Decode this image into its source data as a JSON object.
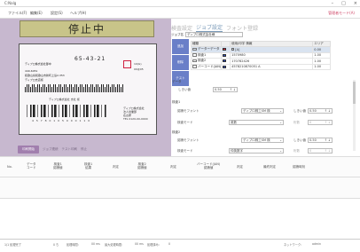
{
  "window": {
    "title": "C:Nalg",
    "admin_label": "管理者モード(A)"
  },
  "menu": {
    "items": [
      "ファイル(F)",
      "編集(E)",
      "設定(S)",
      "ヘルプ(H)"
    ]
  },
  "left": {
    "status_banner": "停止中",
    "label": {
      "postal_code": "65-43-21",
      "line1": "ディプロ株式会社御中",
      "line2": "440-6051",
      "line3": "和歌山県和歌山市新町上島2-353",
      "line4": "ディプロ支店様",
      "small1": "10(G)",
      "small2": "00@05",
      "info1": "ディプロ株式会社 支社 様",
      "info2": "ディプロ株式会社",
      "digits": "4 5 7 8 0 1 0 5 0 0 0 1 1 0",
      "company_lines": [
        "ディプロ株式会社",
        "法人営業部",
        "名古屋",
        "TEL 0120-00-0000"
      ]
    },
    "controls": {
      "btn1": "印刷開始",
      "chk1": "ジョブ連続",
      "chk2": "テスト印刷",
      "btn2": "停止"
    }
  },
  "right": {
    "tabs": [
      "検査設定",
      "ジョブ設定",
      "フォント登録"
    ],
    "active_tab": 1,
    "job_name_label": "ジョブ名",
    "job_name": "ディプロ株式会社様",
    "side_buttons": [
      "追加",
      "削除",
      "テスト"
    ],
    "table": {
      "headers": [
        "種類",
        "",
        "使用/印字 情報",
        "エリア"
      ],
      "rows": [
        {
          "type": "データーデータ",
          "color": "#e03040",
          "value": "[A]",
          "area": "0.00"
        },
        {
          "type": "検査1",
          "color": "#3050c0",
          "value": "1570980",
          "area": "1.00"
        },
        {
          "type": "検査2",
          "color": "#3050c0",
          "value": "170782426",
          "area": "1.00"
        },
        {
          "type": "バーコード(JAN)",
          "color": "#3050c0",
          "value": "4578210870051 A",
          "area": "1.00"
        }
      ]
    },
    "data_group": {
      "title": "データ",
      "threshold_label": "しきい値",
      "threshold_value": "0.50"
    },
    "check1": {
      "title": "検査1",
      "font_label": "認識モフォント",
      "font_value": "ディプロ株工SM 検",
      "threshold_label": "しきい値",
      "threshold_value": "0.50",
      "mode_label": "検査モード",
      "mode_value": "英数",
      "char_label": "桁数",
      "char_value": "0"
    },
    "check2": {
      "title": "検査2",
      "font_label": "認識モフォント",
      "font_value": "ディプロ株工SM 検",
      "threshold_label": "しきい値",
      "threshold_value": "0.50",
      "mode_label": "検査モード",
      "mode_value": "仲英数字",
      "char_label": "桁数",
      "char_value": "0"
    }
  },
  "bands": {
    "top_headers": [
      "No.",
      "データ\nコード",
      "検査1\n認識値",
      "検査1\n結果",
      "判定",
      "検査2\n認識値",
      "判定",
      "バーコード(JAN)\n認識値",
      "判定",
      "最終判定",
      "認識時刻"
    ],
    "bottom_headers": []
  },
  "status": {
    "items": [
      "1/1 処理完了",
      "0 ち",
      "処理時間:",
      "00 ms",
      "最大処理時間:",
      "00 ms",
      "処理済み:",
      "0",
      "ネットワーク:",
      "admin"
    ]
  }
}
